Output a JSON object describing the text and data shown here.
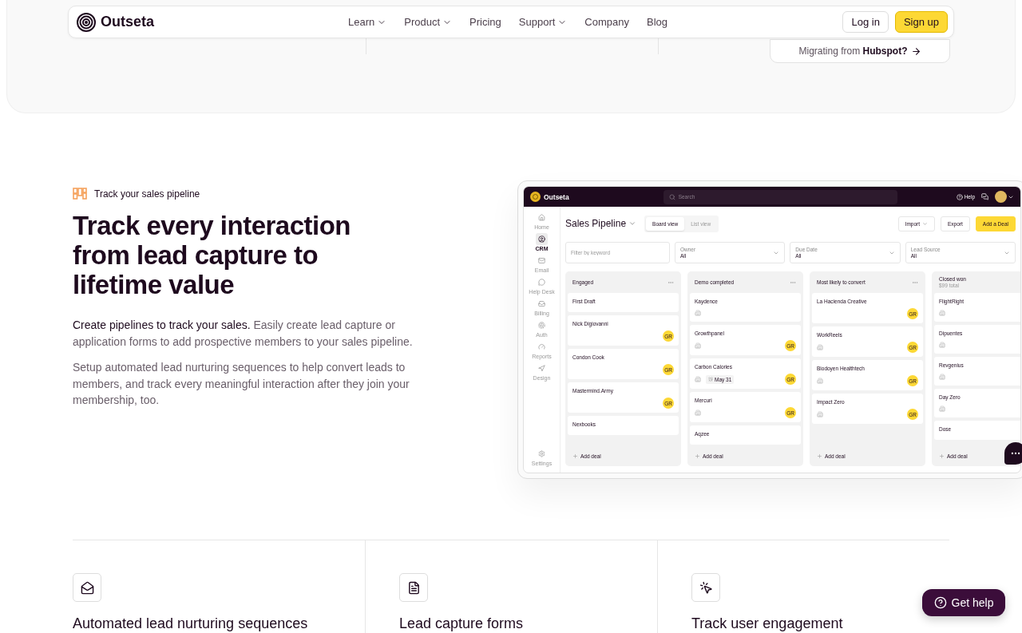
{
  "nav": {
    "brand": "Outseta",
    "links": [
      {
        "label": "Learn",
        "dropdown": true
      },
      {
        "label": "Product",
        "dropdown": true
      },
      {
        "label": "Pricing",
        "dropdown": false
      },
      {
        "label": "Support",
        "dropdown": true
      },
      {
        "label": "Company",
        "dropdown": false
      },
      {
        "label": "Blog",
        "dropdown": false
      }
    ],
    "login": "Log in",
    "signup": "Sign up",
    "migrate": "Migrating from **Hubspot?**"
  },
  "feature": {
    "tag": "Track your sales pipeline",
    "heading": "Track every interaction from lead capture to lifetime value",
    "paragraphs": [
      "**Create pipelines to track your sales.** Easily create lead capture or application forms to add prospective members to your sales pipeline.",
      "Setup automated lead nurturing sequences to help convert leads to members, and track every meaningful interaction after they join your membership, too."
    ]
  },
  "app": {
    "brand": "Outseta",
    "search": {
      "placeholder": "Search"
    },
    "help": "Help",
    "sidebar": [
      {
        "label": "Home",
        "selected": false
      },
      {
        "label": "CRM",
        "selected": true
      },
      {
        "label": "Email",
        "selected": false
      },
      {
        "label": "Help Desk",
        "selected": false
      },
      {
        "label": "Billing",
        "selected": false
      },
      {
        "label": "Auth",
        "selected": false
      },
      {
        "label": "Reports",
        "selected": false
      },
      {
        "label": "Design",
        "selected": false
      }
    ],
    "settings": "Settings",
    "title": "Sales Pipeline",
    "views": [
      {
        "label": "Board view",
        "selected": true
      },
      {
        "label": "List view",
        "selected": false
      }
    ],
    "actions": [
      {
        "label": "Import",
        "kind": "dropdown"
      },
      {
        "label": "Export",
        "kind": "plain"
      },
      {
        "label": "Add a Deal",
        "kind": "primary"
      }
    ],
    "filter": {
      "placeholder": "Filter by keyword"
    },
    "selects": [
      {
        "label": "Owner",
        "value": "All"
      },
      {
        "label": "Due Date",
        "value": "All"
      },
      {
        "label": "Lead Source",
        "value": "All"
      }
    ],
    "columns": [
      {
        "title": "Engaged",
        "menu": true,
        "add": "Add deal",
        "cards": [
          {
            "name": "First Draft",
            "company": false
          },
          {
            "name": "Nick Digiovanni",
            "company": false,
            "owner": "GR"
          },
          {
            "name": "Condon Cook",
            "company": false,
            "owner": "GR"
          },
          {
            "name": "Mastermind.Army",
            "company": false,
            "owner": "GR"
          },
          {
            "name": "Nexbooks",
            "company": false
          }
        ]
      },
      {
        "title": "Demo completed",
        "menu": true,
        "add": "Add deal",
        "cards": [
          {
            "name": "Kaydence",
            "company": true
          },
          {
            "name": "Growthpanel",
            "company": true,
            "owner": "GR"
          },
          {
            "name": "Carbon Calories",
            "company": true,
            "due": "May 31",
            "owner": "GR"
          },
          {
            "name": "Mercuri",
            "company": true,
            "owner": "GR"
          },
          {
            "name": "Aqzee",
            "company": false
          }
        ]
      },
      {
        "title": "Most likely to convert",
        "menu": true,
        "add": "Add deal",
        "cards": [
          {
            "name": "La Hacienda Creative",
            "company": false,
            "owner": "GR"
          },
          {
            "name": "WorkReels",
            "company": true,
            "owner": "GR"
          },
          {
            "name": "Biodoyen Healthtech",
            "company": true,
            "owner": "GR"
          },
          {
            "name": "Impact Zero",
            "company": true,
            "owner": "GR"
          }
        ]
      },
      {
        "title": "Closed won",
        "subtitle": "$99 total",
        "menu": false,
        "add": "Add deal",
        "cards": [
          {
            "name": "FlightRight",
            "company": true
          },
          {
            "name": "Dipuentes",
            "company": true
          },
          {
            "name": "Revgenius",
            "company": true
          },
          {
            "name": "Day Zero",
            "company": true
          },
          {
            "name": "Dose",
            "company": false
          }
        ]
      }
    ]
  },
  "features": [
    {
      "title": "Automated lead nurturing sequences"
    },
    {
      "title": "Lead capture forms"
    },
    {
      "title": "Track user engagement"
    }
  ],
  "help_button": "Get help"
}
